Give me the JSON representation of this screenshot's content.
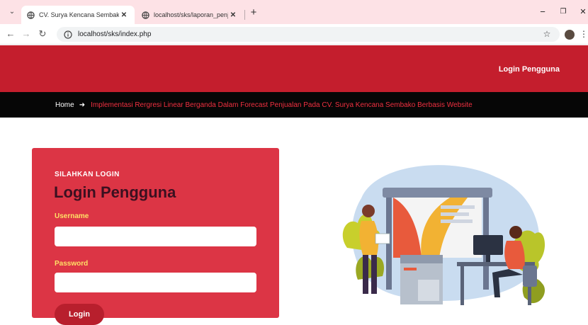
{
  "browser": {
    "tabs": [
      {
        "title": "CV. Surya Kencana Sembako",
        "active": true
      },
      {
        "title": "localhost/sks/laporan_penjuala",
        "active": false
      }
    ],
    "new_tab": "+",
    "url": "localhost/sks/index.php",
    "controls": {
      "minimize": "−",
      "maximize": "❐",
      "close": "✕"
    }
  },
  "header": {
    "login_link": "Login Pengguna",
    "brand_color": "#c41e2d"
  },
  "breadcrumb": {
    "home": "Home",
    "separator": "➜",
    "current": "Implementasi Rergresi Linear Berganda Dalam Forecast Penjualan Pada CV. Surya Kencana Sembako Berbasis Website"
  },
  "login": {
    "eyebrow": "SILAHKAN LOGIN",
    "title": "Login Pengguna",
    "username_label": "Username",
    "username_value": "",
    "password_label": "Password",
    "password_value": "",
    "submit_label": "Login",
    "card_color": "#dc3545"
  },
  "icons": {
    "tab_menu": "chevron-down-icon",
    "favicon": "globe-icon",
    "back": "back-arrow-icon",
    "forward": "forward-arrow-icon",
    "reload": "reload-icon",
    "site_info": "info-icon",
    "bookmark": "star-icon",
    "profile": "profile-avatar-icon",
    "menu": "kebab-menu-icon"
  }
}
